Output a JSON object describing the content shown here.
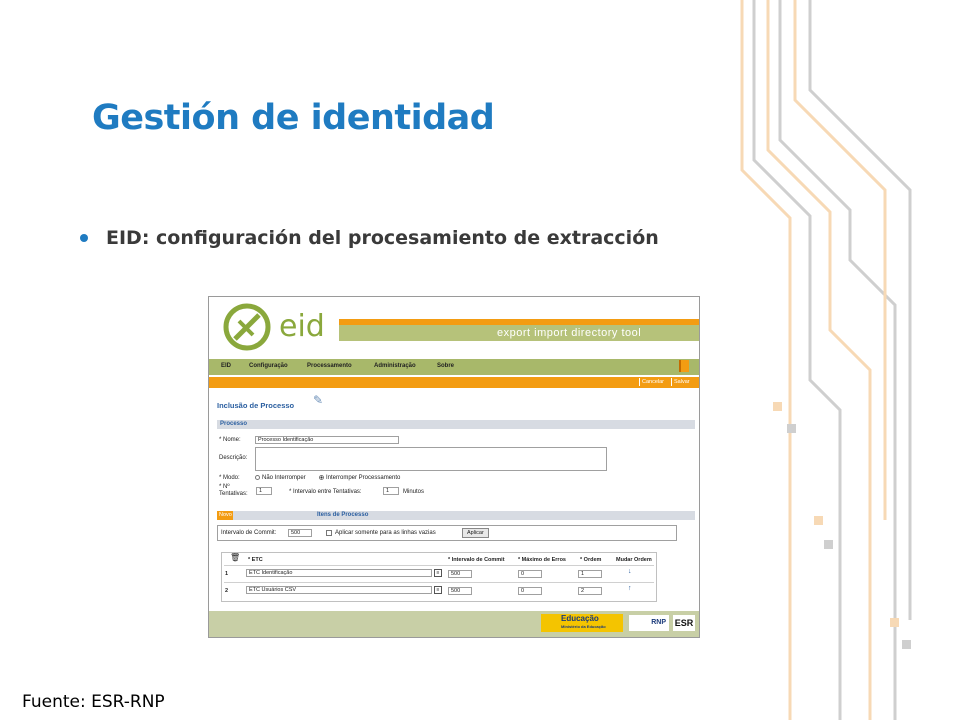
{
  "slide": {
    "title": "Gestión de identidad",
    "bullet": "EID: configuración del procesamiento de extracción",
    "source": "Fuente: ESR-RNP"
  },
  "app": {
    "logo_text": "eid",
    "tagline": "export import directory tool",
    "menu": [
      "EID",
      "Configuração",
      "Processamento",
      "Administração",
      "Sobre"
    ],
    "actions": {
      "cancel": "Cancelar",
      "save": "Salvar"
    },
    "page_title": "Inclusão de Processo",
    "section_process": "Processo",
    "fields": {
      "name_label": "* Nome:",
      "name_value": "Processo Identificação",
      "desc_label": "Descrição:",
      "mode_label": "* Modo:",
      "mode_opt1": "Não Interromper",
      "mode_opt2": "Interromper Processamento",
      "attempts_label_1": "* Nº",
      "attempts_label_2": "Tentativas:",
      "attempts_value": "1",
      "interval_label": "* Intervalo entre Tentativas:",
      "interval_value": "1",
      "interval_unit": "Minutos"
    },
    "items": {
      "tab": "Novo",
      "title": "Itens de Processo",
      "commit_label": "Intervalo de Commit:",
      "commit_value": "500",
      "empty_lines_label": "Aplicar somente para as linhas vazias",
      "apply_button": "Aplicar",
      "columns": [
        "* ETC",
        "* Intervalo de Commit",
        "* Máximo de Erros",
        "* Ordem",
        "Mudar Ordem"
      ],
      "rows": [
        {
          "num": "1",
          "etc": "ETC Identificação",
          "commit": "500",
          "errors": "0",
          "order": "1",
          "move": "↓"
        },
        {
          "num": "2",
          "etc": "ETC Usuários CSV",
          "commit": "500",
          "errors": "0",
          "order": "2",
          "move": "↑"
        }
      ]
    },
    "footer": {
      "edu_title": "Educação",
      "edu_sub": "Ministério da Educação",
      "rnp": "RNP",
      "esr": "ESR"
    }
  },
  "colors": {
    "title_blue": "#1f7bc1",
    "orange": "#f39c12",
    "olive": "#8aa83c"
  }
}
